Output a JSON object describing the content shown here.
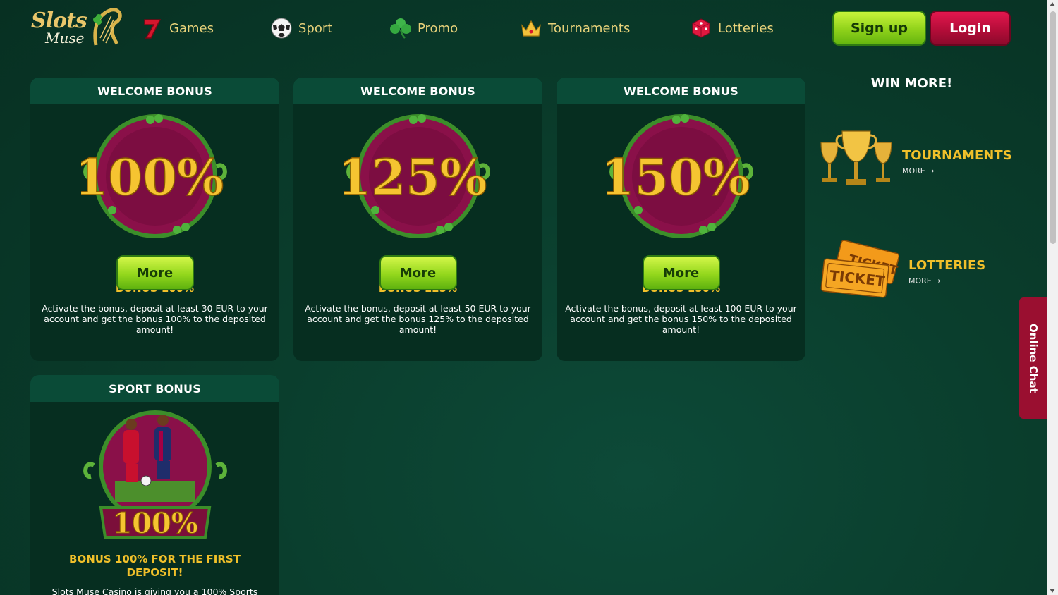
{
  "logo": {
    "word1": "Slots",
    "word2": "Muse"
  },
  "nav": [
    {
      "label": "Games",
      "icon": "seven-icon"
    },
    {
      "label": "Sport",
      "icon": "soccer-ball-icon"
    },
    {
      "label": "Promo",
      "icon": "clover-icon"
    },
    {
      "label": "Tournaments",
      "icon": "crown-icon"
    },
    {
      "label": "Lotteries",
      "icon": "dice-icon"
    }
  ],
  "auth": {
    "signup": "Sign up",
    "login": "Login"
  },
  "cards": [
    {
      "header": "WELCOME BONUS",
      "badge_text": "100%",
      "title": "BONUS 100%",
      "desc": "Activate the bonus, deposit at least 30 EUR to your account and get the bonus 100% to the deposited amount!",
      "button": "More"
    },
    {
      "header": "WELCOME BONUS",
      "badge_text": "125%",
      "title": "BONUS 125%",
      "desc": "Activate the bonus, deposit at least 50 EUR to your account and get the bonus 125% to the deposited amount!",
      "button": "More"
    },
    {
      "header": "WELCOME BONUS",
      "badge_text": "150%",
      "title": "BONUS 150%",
      "desc": "Activate the bonus, deposit at least 100 EUR to your account and get the bonus 150% to the deposited amount!",
      "button": "More"
    },
    {
      "header": "SPORT BONUS",
      "badge_text": "100%",
      "title": "BONUS 100% FOR THE FIRST DEPOSIT!",
      "desc": "Slots Muse Casino is giving you a 100% Sports"
    }
  ],
  "sidebar": {
    "heading": "WIN MORE!",
    "items": [
      {
        "title": "TOURNAMENTS",
        "more": "MORE",
        "icon": "trophies-icon"
      },
      {
        "title": "LOTTERIES",
        "more": "MORE",
        "icon": "tickets-icon",
        "ticket_text": "TICKET"
      }
    ]
  },
  "chat": {
    "label": "Online Chat"
  },
  "colors": {
    "bg": "#0a3d2c",
    "gold": "#f1c02a",
    "green_button": "#93d71c",
    "login_red": "#b00c37",
    "card_bg": "#062e20",
    "card_head": "#0a4b37"
  }
}
